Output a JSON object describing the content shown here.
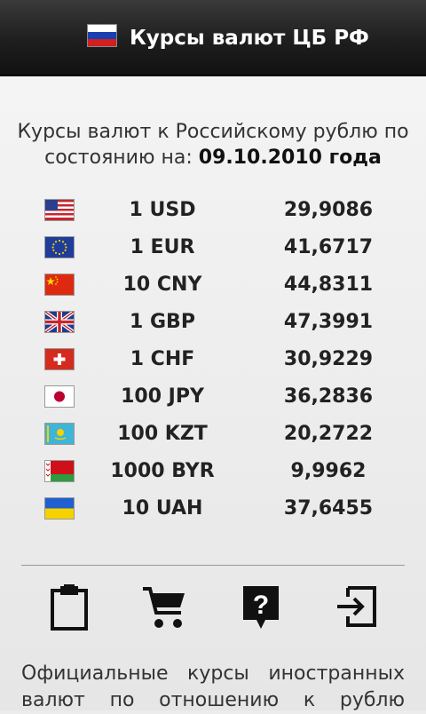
{
  "header": {
    "title": "Курсы валют ЦБ РФ",
    "flag_icon": "russia-flag-icon"
  },
  "intro": {
    "text": "Курсы валют к Российскому рублю по состоянию на:",
    "date": "09.10.2010 года"
  },
  "rates": [
    {
      "code": "1 USD",
      "value": "29,9086",
      "flag": "usa-flag-icon"
    },
    {
      "code": "1 EUR",
      "value": "41,6717",
      "flag": "eu-flag-icon"
    },
    {
      "code": "10 CNY",
      "value": "44,8311",
      "flag": "china-flag-icon"
    },
    {
      "code": "1 GBP",
      "value": "47,3991",
      "flag": "uk-flag-icon"
    },
    {
      "code": "1 CHF",
      "value": "30,9229",
      "flag": "switzerland-flag-icon"
    },
    {
      "code": "100 JPY",
      "value": "36,2836",
      "flag": "japan-flag-icon"
    },
    {
      "code": "100 KZT",
      "value": "20,2722",
      "flag": "kazakhstan-flag-icon"
    },
    {
      "code": "1000 BYR",
      "value": "9,9962",
      "flag": "belarus-flag-icon"
    },
    {
      "code": "10 UAH",
      "value": "37,6455",
      "flag": "ukraine-flag-icon"
    }
  ],
  "toolbar": {
    "icons": [
      "clipboard-icon",
      "cart-icon",
      "help-icon",
      "exit-icon"
    ]
  },
  "footer": {
    "line1": "Официальные курсы иностранных",
    "line2": "валют по отношению к рублю"
  }
}
